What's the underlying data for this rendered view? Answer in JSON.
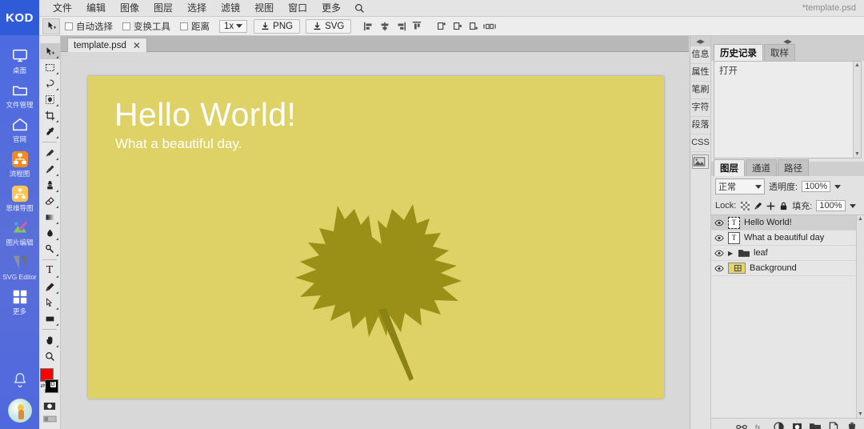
{
  "window": {
    "title": "*template.psd"
  },
  "rail": {
    "logo": "KOD",
    "items": [
      {
        "label": "桌面",
        "icon": "monitor-icon"
      },
      {
        "label": "文件管理",
        "icon": "folder-icon"
      },
      {
        "label": "官网",
        "icon": "home-icon"
      },
      {
        "label": "流程图",
        "icon": "flowchart-icon"
      },
      {
        "label": "思维导图",
        "icon": "mindmap-icon"
      },
      {
        "label": "图片编辑",
        "icon": "image-edit-icon"
      },
      {
        "label": "SVG Editor",
        "icon": "svg-editor-icon"
      },
      {
        "label": "更多",
        "icon": "grid-icon"
      }
    ],
    "notification_icon": "bell-icon",
    "avatar_icon": "user-avatar"
  },
  "menubar": {
    "items": [
      "文件",
      "编辑",
      "图像",
      "图层",
      "选择",
      "滤镜",
      "视图",
      "窗口",
      "更多"
    ],
    "search_icon": "search-icon"
  },
  "options": {
    "active_tool_icon": "move-tool-icon",
    "checkboxes": [
      {
        "label": "自动选择",
        "checked": false
      },
      {
        "label": "变换工具",
        "checked": false
      },
      {
        "label": "距离",
        "checked": false
      }
    ],
    "zoom_level": "1x",
    "export_png": "PNG",
    "export_svg": "SVG",
    "align_icons": [
      "align-left-icon",
      "align-center-h-icon",
      "align-right-icon",
      "align-top-icon"
    ],
    "distribute_icons": [
      "distribute-left-icon",
      "distribute-center-icon",
      "distribute-right-icon",
      "distribute-spacing-icon"
    ]
  },
  "tools": [
    {
      "name": "move-tool",
      "selected": true
    },
    {
      "name": "marquee-tool",
      "selected": false
    },
    {
      "name": "lasso-tool",
      "selected": false
    },
    {
      "name": "quick-select-tool",
      "selected": false
    },
    {
      "name": "crop-tool",
      "selected": false
    },
    {
      "name": "eyedropper-tool",
      "selected": false
    },
    {
      "name": "healing-brush-tool",
      "selected": false
    },
    {
      "name": "brush-tool",
      "selected": false
    },
    {
      "name": "clone-stamp-tool",
      "selected": false
    },
    {
      "name": "eraser-tool",
      "selected": false
    },
    {
      "name": "gradient-tool",
      "selected": false
    },
    {
      "name": "blur-tool",
      "selected": false
    },
    {
      "name": "dodge-tool",
      "selected": false
    },
    {
      "name": "text-tool",
      "selected": false
    },
    {
      "name": "pen-tool",
      "selected": false
    },
    {
      "name": "path-select-tool",
      "selected": false
    },
    {
      "name": "shape-tool",
      "selected": false
    },
    {
      "name": "hand-tool",
      "selected": false
    },
    {
      "name": "zoom-tool",
      "selected": false
    }
  ],
  "colors": {
    "foreground": "#ff0000",
    "background": "#000000",
    "canvas_bg": "#ded166",
    "leaf": "#9a9017",
    "rail_blue": "#4c6fe0"
  },
  "document": {
    "tab_label": "template.psd",
    "close_icon": "close-icon"
  },
  "canvas": {
    "heading": "Hello World!",
    "subheading": "What a beautiful day.",
    "artwork": "maple-leaf"
  },
  "right_strip": {
    "tabs": [
      "信息",
      "属性",
      "笔刷",
      "字符",
      "段落",
      "CSS"
    ],
    "image_tab_icon": "image-icon"
  },
  "history_panel": {
    "tabs": [
      {
        "label": "历史记录",
        "active": true
      },
      {
        "label": "取样",
        "active": false
      }
    ],
    "items": [
      "打开"
    ]
  },
  "layers_panel": {
    "tabs": [
      {
        "label": "图层",
        "active": true
      },
      {
        "label": "通道",
        "active": false
      },
      {
        "label": "路径",
        "active": false
      }
    ],
    "blend_mode": "正常",
    "opacity_label": "透明度:",
    "opacity_value": "100%",
    "lock_label": "Lock:",
    "fill_label": "填充:",
    "fill_value": "100%",
    "lock_icons": [
      "lock-transparent-icon",
      "lock-paint-icon",
      "lock-move-icon",
      "lock-all-icon"
    ],
    "layers": [
      {
        "name": "Hello World!",
        "type": "text",
        "visible": true,
        "selected": true
      },
      {
        "name": "What a beautiful day",
        "type": "text",
        "visible": true,
        "selected": false
      },
      {
        "name": "leaf",
        "type": "group",
        "visible": true,
        "selected": false,
        "expanded": false
      },
      {
        "name": "Background",
        "type": "image",
        "visible": true,
        "selected": false
      }
    ],
    "bottom_icons": [
      "link-layers-icon",
      "layer-effects-icon",
      "adjustment-layer-icon",
      "layer-mask-icon",
      "new-group-icon",
      "new-layer-icon",
      "delete-layer-icon"
    ]
  }
}
